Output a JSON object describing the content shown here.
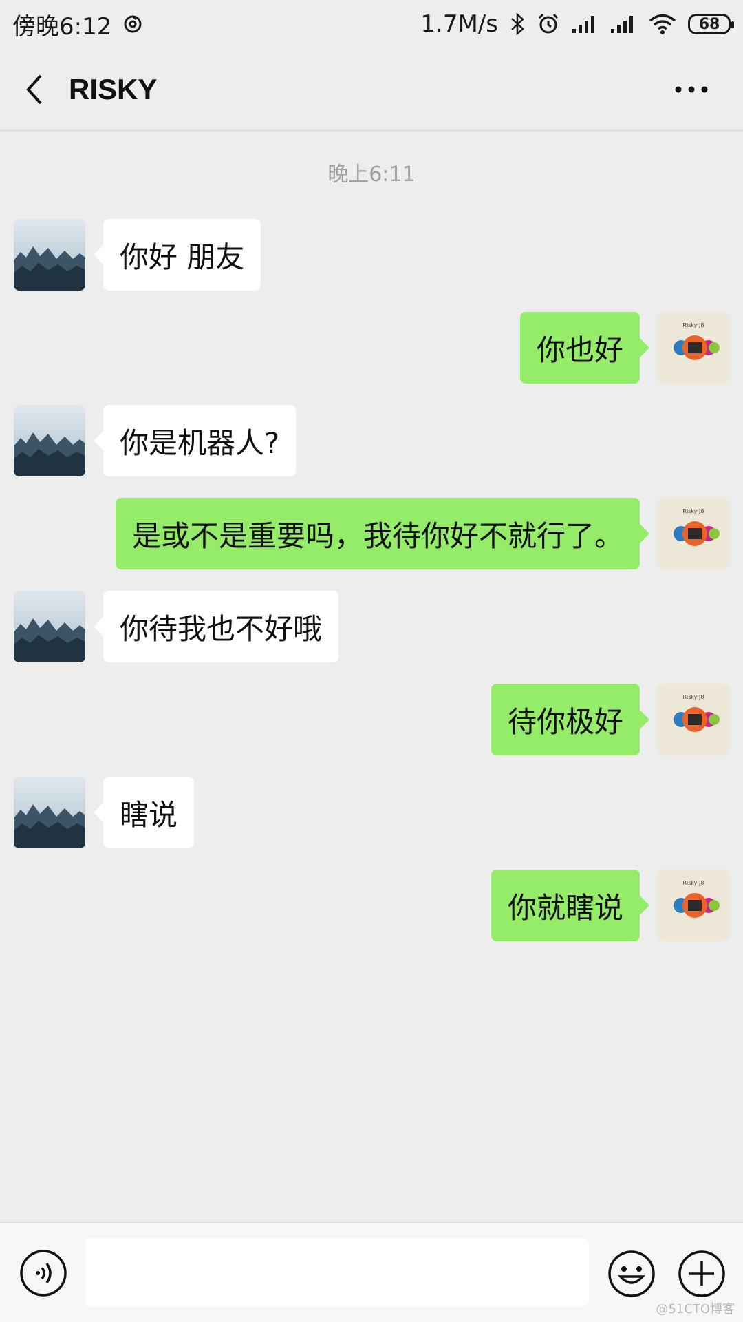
{
  "status_bar": {
    "time": "傍晚6:12",
    "net_speed": "1.7M/s",
    "battery": "68",
    "icons": [
      "sync-icon",
      "bluetooth-icon",
      "alarm-icon",
      "signal-icon",
      "signal-icon",
      "wifi-icon",
      "battery-icon"
    ]
  },
  "header": {
    "title": "RISKY",
    "back_icon": "chevron-left-icon",
    "more_icon": "more-dots-icon"
  },
  "chat": {
    "timestamp": "晚上6:11",
    "messages": [
      {
        "side": "in",
        "text": "你好 朋友"
      },
      {
        "side": "out",
        "text": "你也好"
      },
      {
        "side": "in",
        "text": "你是机器人?"
      },
      {
        "side": "out",
        "text": "是或不是重要吗，我待你好不就行了。"
      },
      {
        "side": "in",
        "text": "你待我也不好哦"
      },
      {
        "side": "out",
        "text": "待你极好"
      },
      {
        "side": "in",
        "text": "瞎说"
      },
      {
        "side": "out",
        "text": "你就瞎说"
      }
    ]
  },
  "avatar_self_label": "Risky J8",
  "input_bar": {
    "input_value": "",
    "voice_icon": "voice-icon",
    "emoji_icon": "emoji-icon",
    "plus_icon": "plus-icon"
  },
  "watermark": "@51CTO博客",
  "colors": {
    "background": "#ededed",
    "bubble_out": "#95ec69",
    "bubble_in": "#ffffff"
  }
}
